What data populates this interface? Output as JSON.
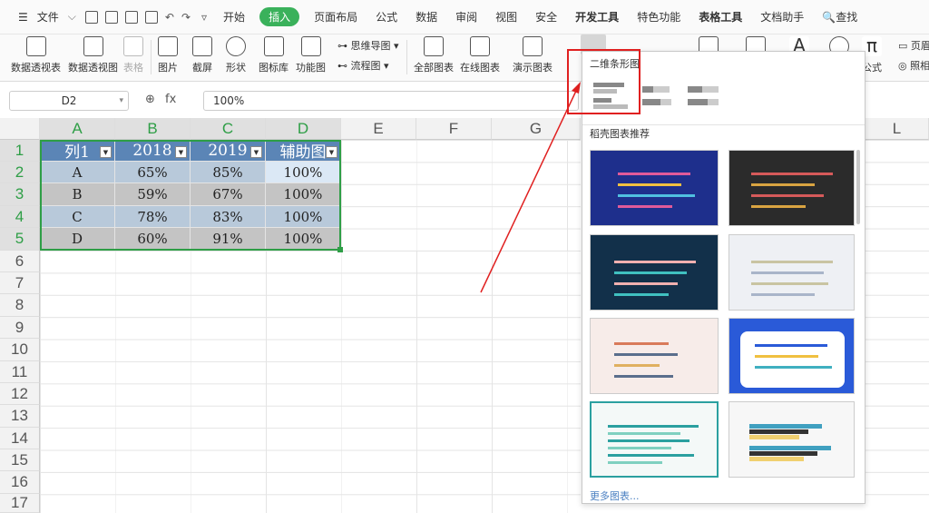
{
  "menu": {
    "file": "文件",
    "items": [
      "开始",
      "插入",
      "页面布局",
      "公式",
      "数据",
      "审阅",
      "视图",
      "安全",
      "开发工具",
      "特色功能",
      "表格工具",
      "文档助手"
    ],
    "search": "查找"
  },
  "ribbon": {
    "pivot_table": "数据透视表",
    "pivot_chart": "数据透视图",
    "table": "表格",
    "picture": "图片",
    "screenshot": "截屏",
    "shapes": "形状",
    "icon_lib": "图标库",
    "func_chart": "功能图",
    "mindmap": "思维导图",
    "flowchart": "流程图",
    "all_charts": "全部图表",
    "online_chart": "在线图表",
    "demo_chart": "演示图表",
    "formula": "公式",
    "header": "页眉",
    "photo": "照相"
  },
  "formula_bar": {
    "name_box": "D2",
    "fx": "fx",
    "value": "100%"
  },
  "columns": [
    "A",
    "B",
    "C",
    "D",
    "E",
    "F",
    "G",
    "L"
  ],
  "rows": [
    "1",
    "2",
    "3",
    "4",
    "5",
    "6",
    "7",
    "8",
    "9",
    "10",
    "11",
    "12",
    "13",
    "14",
    "15",
    "16",
    "17"
  ],
  "table": {
    "headers": [
      "列1",
      "2018",
      "2019",
      "辅助图"
    ],
    "data": [
      [
        "A",
        "65%",
        "85%",
        "100%"
      ],
      [
        "B",
        "59%",
        "67%",
        "100%"
      ],
      [
        "C",
        "78%",
        "83%",
        "100%"
      ],
      [
        "D",
        "60%",
        "91%",
        "100%"
      ]
    ]
  },
  "panel": {
    "title": "二维条形图",
    "recommend": "稻壳图表推荐",
    "more": "更多图表..."
  },
  "colors": {
    "accent": "#3ab15b",
    "table_header": "#5b85b6",
    "row_blue": "#b8c9da",
    "row_gray": "#c4c4c4",
    "highlight": "#e02020"
  }
}
